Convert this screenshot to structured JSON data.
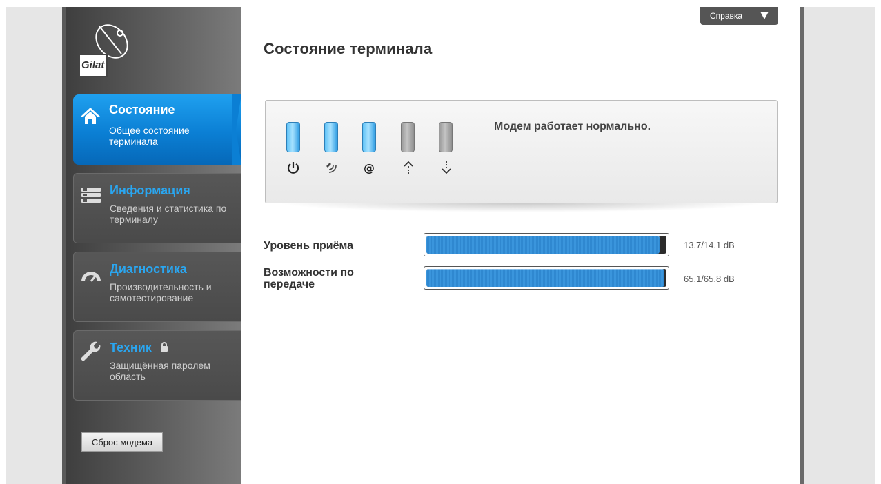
{
  "app": {
    "logo_text": "Gilat"
  },
  "header": {
    "help_label": "Справка"
  },
  "page": {
    "title": "Состояние терминала"
  },
  "sidebar": {
    "items": [
      {
        "title": "Состояние",
        "subtitle": "Общее состояние терминала",
        "icon": "home-icon",
        "active": true
      },
      {
        "title": "Информация",
        "subtitle": "Сведения и статистика по терминалу",
        "icon": "list-icon",
        "active": false
      },
      {
        "title": "Диагностика",
        "subtitle": "Производительность и самотестирование",
        "icon": "gauge-icon",
        "active": false
      },
      {
        "title": "Техник",
        "subtitle": "Защищённая паролем область",
        "icon": "wrench-icon",
        "locked": true,
        "active": false
      }
    ],
    "reset_label": "Сброс модема"
  },
  "status": {
    "message": "Модем работает нормально.",
    "leds": [
      {
        "icon": "power-icon",
        "on": true
      },
      {
        "icon": "satellite-signal-icon",
        "on": true
      },
      {
        "icon": "at-icon",
        "on": true
      },
      {
        "icon": "upload-icon",
        "on": false
      },
      {
        "icon": "download-icon",
        "on": false
      }
    ]
  },
  "meters": [
    {
      "label": "Уровень приёма",
      "value": "13.7/14.1 dB",
      "fraction": 0.97
    },
    {
      "label": "Возможности по передаче",
      "value": "65.1/65.8 dB",
      "fraction": 0.99
    }
  ],
  "colors": {
    "accent": "#1a8fe3",
    "nav_title": "#2aa6f0",
    "led_on": "#5fc3f7"
  }
}
